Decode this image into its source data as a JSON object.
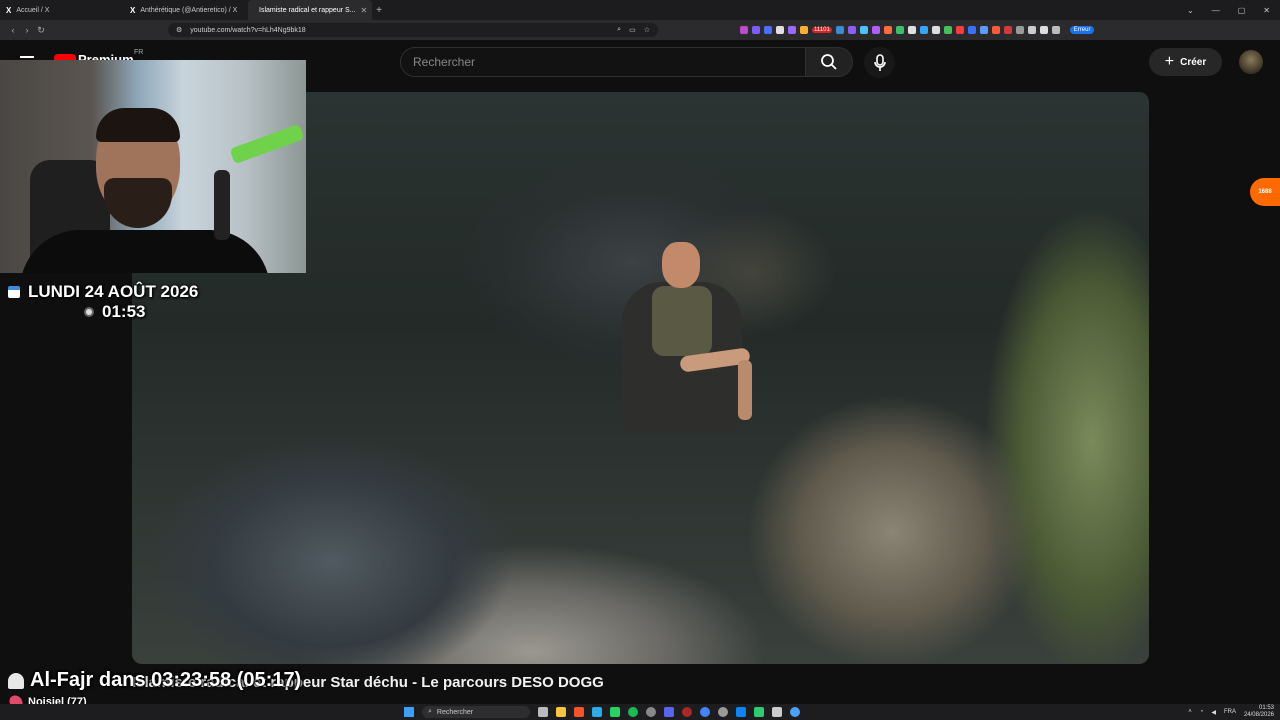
{
  "browser": {
    "tabs": [
      {
        "label": "Accueil / X",
        "icon": "x-logo-icon",
        "active": false
      },
      {
        "label": "Anthérétique (@Antieretico) / X",
        "icon": "x-logo-icon",
        "active": false
      },
      {
        "label": "Islamiste radical et rappeur S...",
        "icon": "youtube-icon",
        "active": true
      }
    ],
    "new_tab": "+",
    "url": "youtube.com/watch?v=hLh4Ng9bk18",
    "badge": "11101",
    "error_pill": "Erreur"
  },
  "youtube": {
    "logo_text": "Premium",
    "country": "FR",
    "search_placeholder": "Rechercher",
    "create_label": "Créer"
  },
  "overlay": {
    "date": "LUNDI 24 AOÛT 2026",
    "time": "01:53",
    "prayer": "Al-Fajr dans 03:23:58 (05:17)",
    "location": "Noisiel (77)"
  },
  "video": {
    "title": "Islamiste radical et rappeur Star déchu - Le parcours DESO DOGG"
  },
  "side_badge": "1688",
  "taskbar": {
    "search": "Rechercher",
    "lang": "FRA",
    "time": "01:53",
    "date": "24/08/2026"
  },
  "colors": {
    "accent_red": "#ff0000",
    "mic_green": "#6fd24a"
  }
}
